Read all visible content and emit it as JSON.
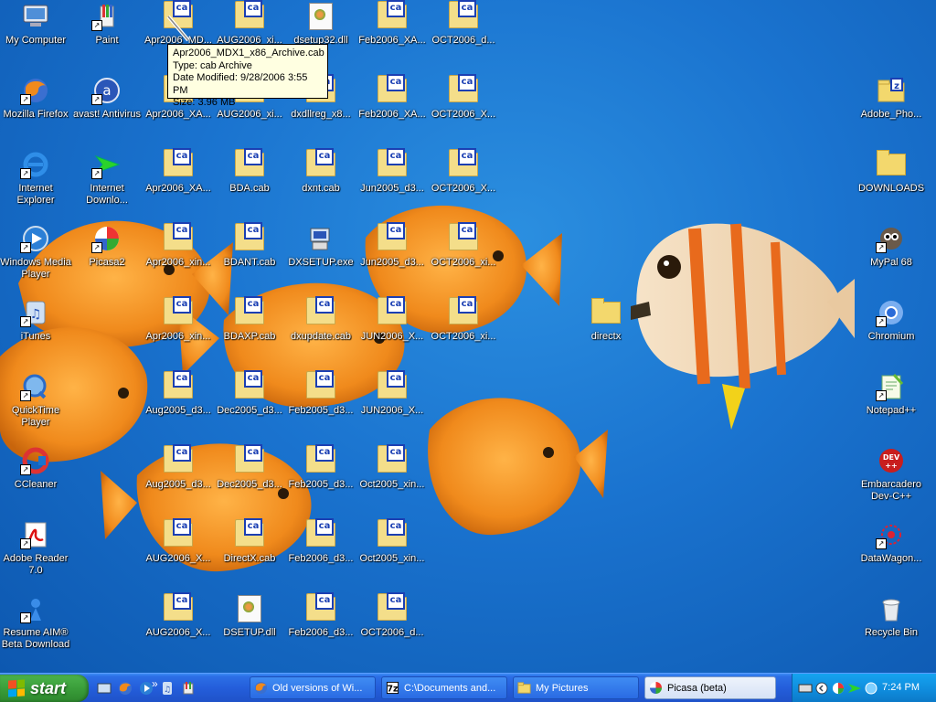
{
  "desktop": {
    "left_column": [
      {
        "label": "My Computer",
        "icon": "my-computer-icon",
        "shortcut": false
      },
      {
        "label": "Paint",
        "icon": "paint-icon",
        "shortcut": true
      },
      {
        "label": "Mozilla Firefox",
        "icon": "firefox-icon",
        "shortcut": true
      },
      {
        "label": "avast! Antivirus",
        "icon": "avast-icon",
        "shortcut": true
      },
      {
        "label": "Internet Explorer",
        "icon": "internet-explorer-icon",
        "shortcut": true
      },
      {
        "label": "Internet Downlo...",
        "icon": "internet-download-manager-icon",
        "shortcut": true
      },
      {
        "label": "Windows Media Player",
        "icon": "windows-media-player-icon",
        "shortcut": true
      },
      {
        "label": "Picasa2",
        "icon": "picasa-icon",
        "shortcut": true
      },
      {
        "label": "iTunes",
        "icon": "itunes-icon",
        "shortcut": true
      },
      {
        "label": "QuickTime Player",
        "icon": "quicktime-icon",
        "shortcut": true
      },
      {
        "label": "CCleaner",
        "icon": "ccleaner-icon",
        "shortcut": true
      },
      {
        "label": "Adobe Reader 7.0",
        "icon": "adobe-reader-icon",
        "shortcut": true
      },
      {
        "label": "Resume AIM® Beta Download",
        "icon": "aim-icon",
        "shortcut": true
      }
    ],
    "files": [
      [
        "Apr2006_MD...",
        "Apr2006_XA...",
        "Apr2006_XA...",
        "Apr2006_xin...",
        "Apr2006_xin...",
        "Aug2005_d3...",
        "Aug2005_d3...",
        "AUG2006_X...",
        "AUG2006_X..."
      ],
      [
        "AUG2006_xi...",
        "AUG2006_xi...",
        "BDA.cab",
        "BDANT.cab",
        "BDAXP.cab",
        "Dec2005_d3...",
        "Dec2005_d3...",
        "DirectX.cab",
        "DSETUP.dll"
      ],
      [
        "dsetup32.dll",
        "dxdllreg_x8...",
        "dxnt.cab",
        "DXSETUP.exe",
        "dxupdate.cab",
        "Feb2005_d3...",
        "Feb2005_d3...",
        "Feb2006_d3...",
        "Feb2006_d3..."
      ],
      [
        "Feb2006_XA...",
        "Feb2006_XA...",
        "Jun2005_d3...",
        "Jun2005_d3...",
        "JUN2006_X...",
        "JUN2006_X...",
        "Oct2005_xin...",
        "Oct2005_xin...",
        "OCT2006_d..."
      ],
      [
        "OCT2006_d...",
        "OCT2006_X...",
        "OCT2006_X...",
        "OCT2006_xi...",
        "OCT2006_xi..."
      ]
    ],
    "directx_folder": "directx",
    "right_column": [
      {
        "label": "Adobe_Pho...",
        "icon": "zip-folder-icon"
      },
      {
        "label": "DOWNLOADS",
        "icon": "folder-icon"
      },
      {
        "label": "MyPal 68",
        "icon": "mypal-icon"
      },
      {
        "label": "Chromium",
        "icon": "chromium-icon"
      },
      {
        "label": "Notepad++",
        "icon": "notepad-plus-plus-icon"
      },
      {
        "label": "Embarcadero Dev-C++",
        "icon": "dev-cpp-icon"
      },
      {
        "label": "DataWagon...",
        "icon": "datawagon-icon"
      },
      {
        "label": "Recycle Bin",
        "icon": "recycle-bin-icon"
      }
    ]
  },
  "tooltip": {
    "line1": "Apr2006_MDX1_x86_Archive.cab",
    "line2": "Type: cab Archive",
    "line3": "Date Modified: 9/28/2006 3:55 PM",
    "line4": "Size: 3.96 MB"
  },
  "taskbar": {
    "start_label": "start",
    "more_symbol": "»",
    "tasks": [
      {
        "label": "Old versions of Wi...",
        "icon": "firefox-icon",
        "active": false
      },
      {
        "label": "C:\\Documents and...",
        "icon": "7zip-icon",
        "active": false
      },
      {
        "label": "My Pictures",
        "icon": "folder-icon",
        "active": false
      },
      {
        "label": "Picasa (beta)",
        "icon": "picasa-icon",
        "active": true
      }
    ],
    "clock": "7:24 PM"
  },
  "colors": {
    "desktop_blue": "#1a73cf",
    "taskbar_blue": "#245edb",
    "start_green": "#3a9e3a",
    "tray_blue": "#0f8bdc",
    "tooltip_bg": "#ffffe1"
  }
}
